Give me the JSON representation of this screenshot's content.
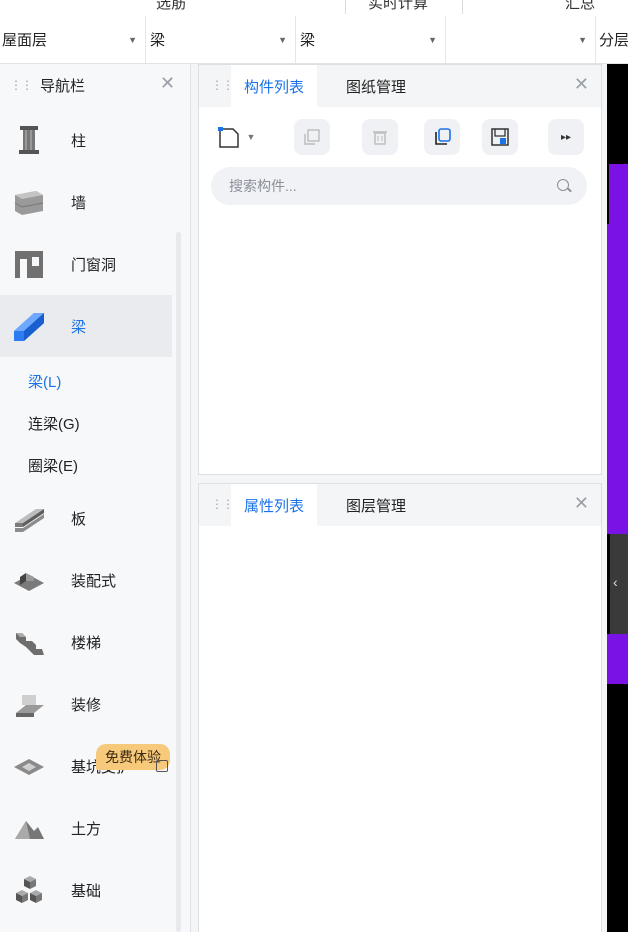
{
  "ribbon": {
    "labels": [
      "选筋",
      "实时计算",
      "汇总"
    ]
  },
  "selectors": [
    {
      "value": "屋面层"
    },
    {
      "value": "梁"
    },
    {
      "value": "梁"
    },
    {
      "value": ""
    },
    {
      "value": "分层"
    }
  ],
  "nav": {
    "title": "导航栏",
    "items": [
      {
        "label": "柱",
        "icon": "column-icon"
      },
      {
        "label": "墙",
        "icon": "wall-icon"
      },
      {
        "label": "门窗洞",
        "icon": "door-window-icon"
      },
      {
        "label": "梁",
        "icon": "beam-icon",
        "active": true
      },
      {
        "label": "板",
        "icon": "slab-icon"
      },
      {
        "label": "装配式",
        "icon": "prefab-icon"
      },
      {
        "label": "楼梯",
        "icon": "stairs-icon"
      },
      {
        "label": "装修",
        "icon": "decoration-icon"
      },
      {
        "label": "基坑支护",
        "icon": "foundation-pit-icon"
      },
      {
        "label": "土方",
        "icon": "earthwork-icon"
      },
      {
        "label": "基础",
        "icon": "foundation-icon"
      }
    ],
    "sub_items": [
      {
        "label": "梁(L)",
        "active": true
      },
      {
        "label": "连梁(G)"
      },
      {
        "label": "圈梁(E)"
      }
    ],
    "badge": "免费体验"
  },
  "component_panel": {
    "tabs": [
      {
        "label": "构件列表",
        "active": true
      },
      {
        "label": "图纸管理"
      }
    ],
    "search_placeholder": "搜索构件..."
  },
  "property_panel": {
    "tabs": [
      {
        "label": "属性列表",
        "active": true
      },
      {
        "label": "图层管理"
      }
    ]
  },
  "colors": {
    "accent": "#1a73e8",
    "viewport_purple": "#7a12e6",
    "badge": "#f7c97b"
  }
}
